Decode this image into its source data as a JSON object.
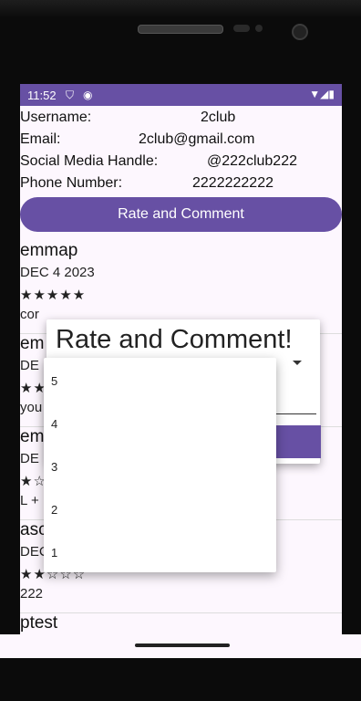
{
  "status_bar": {
    "time": "11:52",
    "icons_left": [
      "shield-icon",
      "circle-icon"
    ],
    "icons_right": [
      "wifi-icon",
      "signal-icon",
      "battery-icon"
    ]
  },
  "profile": {
    "username_label": "Username:",
    "username_value": "2club",
    "email_label": "Email:",
    "email_value": "2club@gmail.com",
    "social_label": "Social Media Handle:",
    "social_value": "@222club222",
    "phone_label": "Phone Number:",
    "phone_value": "2222222222"
  },
  "rate_button_label": "Rate and Comment",
  "entries": [
    {
      "user": "emmap",
      "date": "DEC 4 2023",
      "stars": "★★★★★",
      "comment": "cor"
    },
    {
      "user": "em",
      "date": "DE",
      "stars": "★★",
      "comment": "you"
    },
    {
      "user": "em",
      "date": "DE",
      "stars": "★☆",
      "comment": "L +"
    },
    {
      "user": "asc",
      "date": "DEC 4 2023",
      "stars": "★★☆☆☆",
      "comment": "222"
    },
    {
      "user": "ptest",
      "date": "",
      "stars": "",
      "comment": ""
    }
  ],
  "dialog": {
    "title": "Rate and Comment!"
  },
  "rating_menu": {
    "options": [
      "5",
      "4",
      "3",
      "2",
      "1"
    ]
  },
  "colors": {
    "primary": "#6750a4",
    "background": "#fdf7fe"
  }
}
